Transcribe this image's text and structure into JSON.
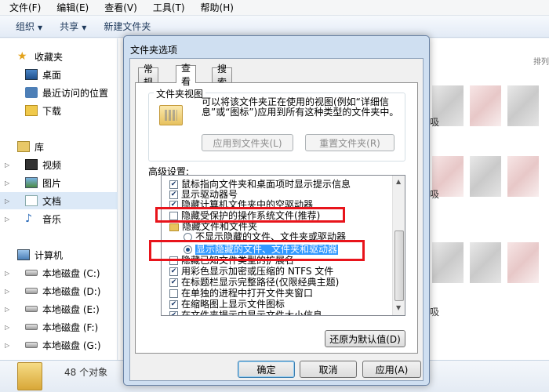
{
  "menubar": [
    "文件(F)",
    "编辑(E)",
    "查看(V)",
    "工具(T)",
    "帮助(H)"
  ],
  "toolbar": {
    "organize": "组织",
    "share": "共享",
    "new_folder": "新建文件夹"
  },
  "nav": {
    "favorites": "收藏夹",
    "desktop": "桌面",
    "recent": "最近访问的位置",
    "downloads": "下载",
    "libraries": "库",
    "videos": "视频",
    "pictures": "图片",
    "documents": "文档",
    "music": "音乐",
    "computer": "计算机",
    "disks": [
      "本地磁盘 (C:)",
      "本地磁盘 (D:)",
      "本地磁盘 (E:)",
      "本地磁盘 (F:)",
      "本地磁盘 (G:)"
    ]
  },
  "content": {
    "sort_hint": "排列",
    "side_labels": [
      "吸",
      "吸",
      "吸"
    ]
  },
  "status": {
    "count": "48 个对象"
  },
  "dialog": {
    "title": "文件夹选项",
    "tabs": [
      "常规",
      "查看",
      "搜索"
    ],
    "group_title": "文件夹视图",
    "group_desc": "可以将该文件夹正在使用的视图(例如“详细信息”或“图标”)应用到所有这种类型的文件夹中。",
    "apply_button": "应用到文件夹(L)",
    "reset_button": "重置文件夹(R)",
    "advanced_label": "高级设置:",
    "tree": [
      {
        "type": "checkbox",
        "checked": true,
        "indent": 0,
        "label": "鼠标指向文件夹和桌面项时显示提示信息"
      },
      {
        "type": "checkbox",
        "checked": true,
        "indent": 0,
        "label": "显示驱动器号"
      },
      {
        "type": "checkbox",
        "checked": true,
        "indent": 0,
        "label": "隐藏计算机文件夹中的空驱动器"
      },
      {
        "type": "checkbox",
        "checked": false,
        "indent": 0,
        "label": "隐藏受保护的操作系统文件(推荐)"
      },
      {
        "type": "folder",
        "checked": false,
        "indent": 0,
        "label": "隐藏文件和文件夹"
      },
      {
        "type": "radio",
        "checked": false,
        "indent": 1,
        "label": "不显示隐藏的文件、文件夹或驱动器"
      },
      {
        "type": "radio",
        "checked": true,
        "indent": 1,
        "label": "显示隐藏的文件、文件夹和驱动器"
      },
      {
        "type": "checkbox",
        "checked": false,
        "indent": 0,
        "label": "隐藏已知文件类型的扩展名"
      },
      {
        "type": "checkbox",
        "checked": true,
        "indent": 0,
        "label": "用彩色显示加密或压缩的 NTFS 文件"
      },
      {
        "type": "checkbox",
        "checked": true,
        "indent": 0,
        "label": "在标题栏显示完整路径(仅限经典主题)"
      },
      {
        "type": "checkbox",
        "checked": false,
        "indent": 0,
        "label": "在单独的进程中打开文件夹窗口"
      },
      {
        "type": "checkbox",
        "checked": true,
        "indent": 0,
        "label": "在缩略图上显示文件图标"
      },
      {
        "type": "checkbox",
        "checked": true,
        "indent": 0,
        "label": "在文件夹提示中显示文件大小信息"
      }
    ],
    "restore_button": "还原为默认值(D)",
    "ok_button": "确定",
    "cancel_button": "取消",
    "apply_dialog_button": "应用(A)"
  },
  "colors": {
    "highlight": "#e8141b",
    "selection": "#3399ff"
  }
}
